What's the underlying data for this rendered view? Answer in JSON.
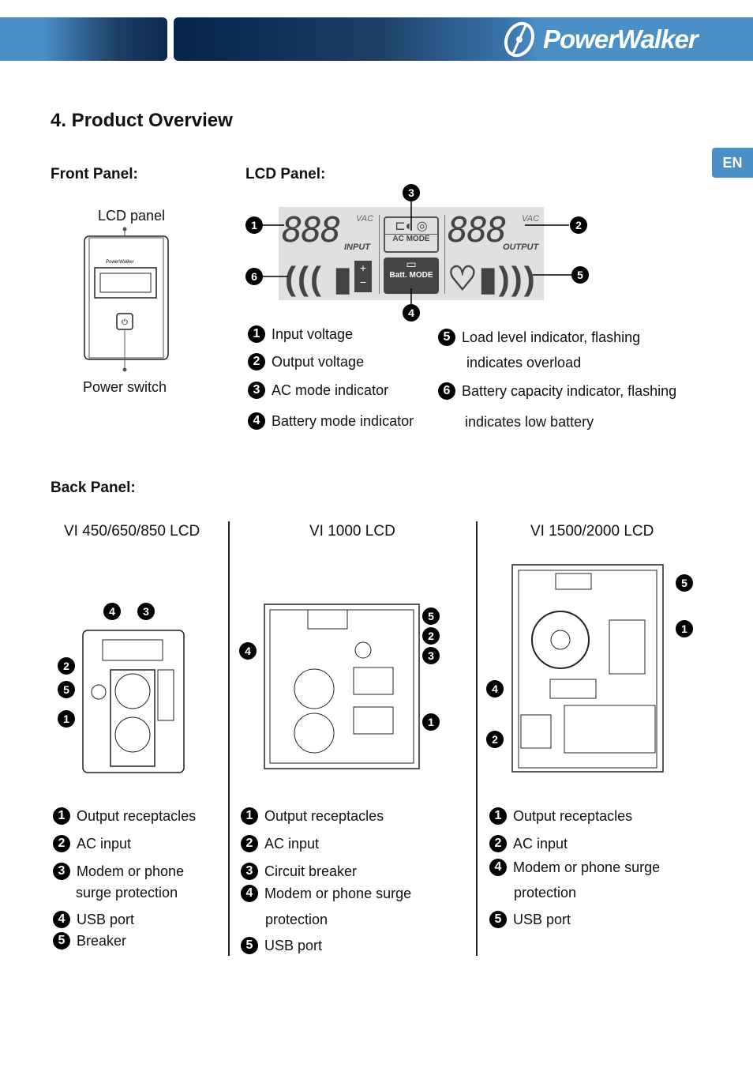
{
  "header": {
    "brand": "PowerWalker",
    "lang": "EN"
  },
  "title": "4. Product Overview",
  "front": {
    "heading": "Front Panel:",
    "lcd_label": "LCD panel",
    "switch_label": "Power switch"
  },
  "lcd": {
    "heading": "LCD Panel:",
    "digits": "888",
    "unit": "VAC",
    "input": "INPUT",
    "output": "OUTPUT",
    "ac_mode": "AC MODE",
    "batt_mode": "Batt. MODE",
    "items": [
      {
        "n": "1",
        "text": "Input voltage"
      },
      {
        "n": "2",
        "text": "Output voltage"
      },
      {
        "n": "3",
        "text": "AC mode indicator"
      },
      {
        "n": "4",
        "text": "Battery mode indicator"
      },
      {
        "n": "5",
        "text": "Load level indicator, flashing",
        "text2": "indicates overload"
      },
      {
        "n": "6",
        "text": "Battery capacity indicator, flashing",
        "text2": "indicates low battery"
      }
    ]
  },
  "back": {
    "heading": "Back Panel:",
    "models": [
      {
        "name": "VI 450/650/850 LCD",
        "items": [
          {
            "n": "1",
            "text": "Output receptacles"
          },
          {
            "n": "2",
            "text": "AC input"
          },
          {
            "n": "3",
            "text": "Modem or phone",
            "text2": "surge protection"
          },
          {
            "n": "4",
            "text": "USB port"
          },
          {
            "n": "5",
            "text": "Breaker"
          }
        ]
      },
      {
        "name": "VI 1000 LCD",
        "items": [
          {
            "n": "1",
            "text": "Output receptacles"
          },
          {
            "n": "2",
            "text": "AC input"
          },
          {
            "n": "3",
            "text": "Circuit breaker"
          },
          {
            "n": "4",
            "text": "Modem or phone surge",
            "text2": "protection"
          },
          {
            "n": "5",
            "text": "USB port"
          }
        ]
      },
      {
        "name": "VI 1500/2000 LCD",
        "items": [
          {
            "n": "1",
            "text": "Output receptacles"
          },
          {
            "n": "2",
            "text": "AC input"
          },
          {
            "n": "4",
            "text": "Modem or phone surge",
            "text2": "protection"
          },
          {
            "n": "5",
            "text": "USB port"
          }
        ]
      }
    ]
  }
}
